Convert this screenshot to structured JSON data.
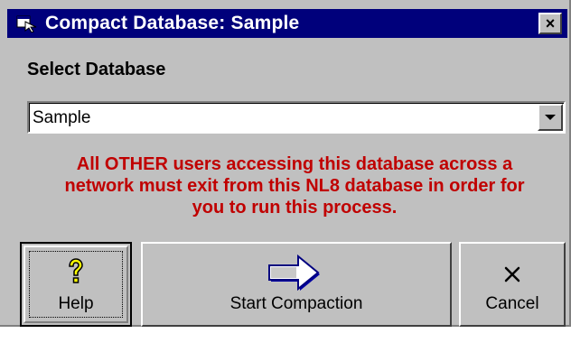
{
  "window": {
    "title": "Compact Database: Sample",
    "icon": "app-window-icon",
    "close_label": "×"
  },
  "select": {
    "label": "Select Database",
    "value": "Sample",
    "arrow_icon": "dropdown-arrow-icon"
  },
  "warning": {
    "line1": "All OTHER users accessing this database across a",
    "line2": "network must exit from this NL8 database in order for",
    "line3": "you to run this process.",
    "color": "#c00000"
  },
  "buttons": {
    "help": {
      "label": "Help",
      "icon": "question-mark-icon"
    },
    "start": {
      "label": "Start Compaction",
      "icon": "right-arrow-icon"
    },
    "cancel": {
      "label": "Cancel",
      "icon": "close-x-icon"
    }
  },
  "colors": {
    "titlebar": "#00007b",
    "face": "#c0c0c0"
  }
}
